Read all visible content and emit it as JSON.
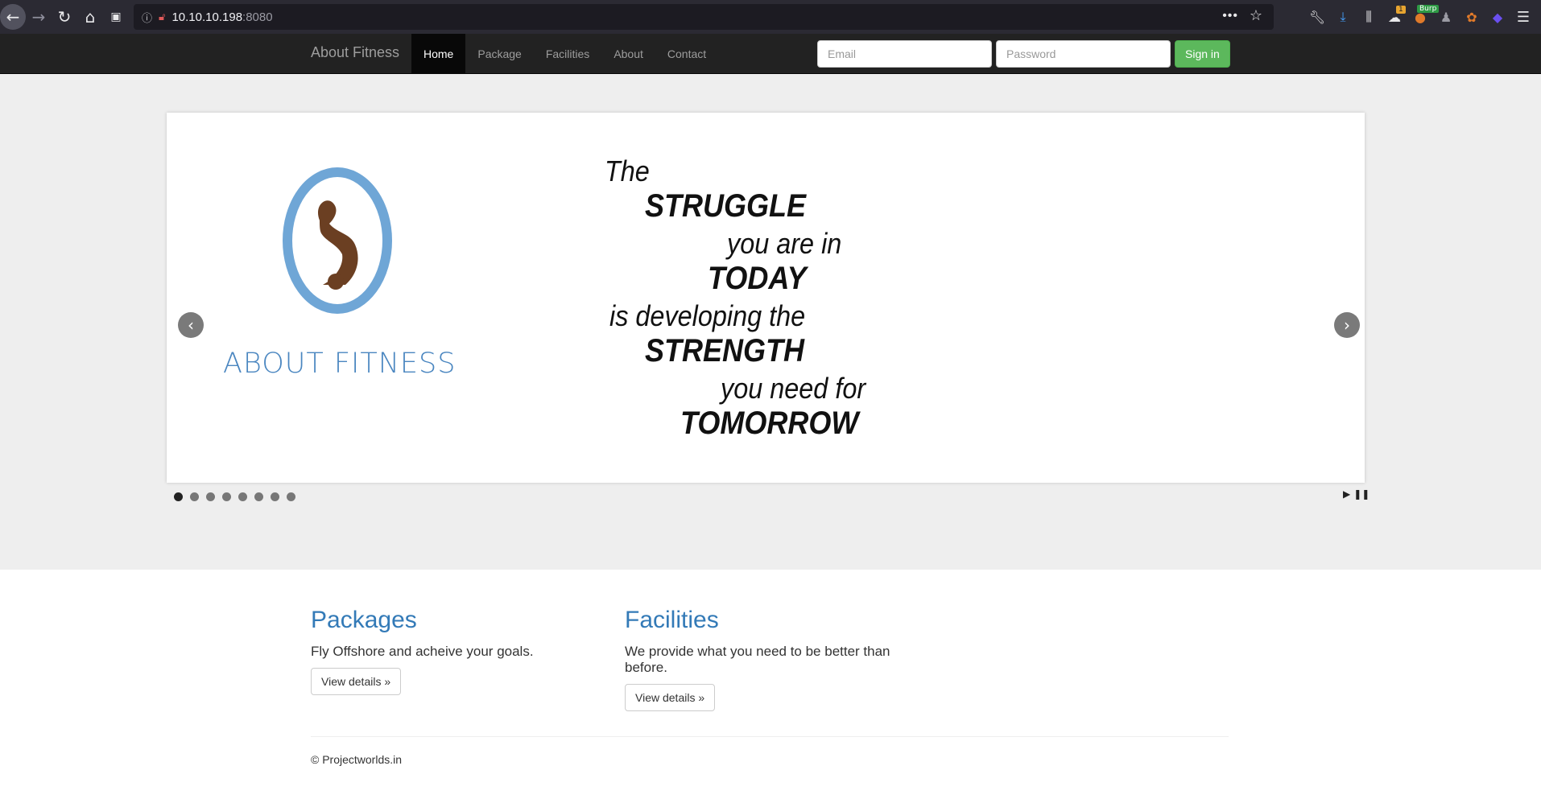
{
  "browser": {
    "url_host": "10.10.10.198",
    "url_port": ":8080",
    "icons": [
      "back-icon",
      "forward-icon",
      "reload-icon",
      "home-icon",
      "reader-icon",
      "info-icon",
      "insecure-lock-icon",
      "more-icon",
      "bookmark-star-icon",
      "wrench-icon",
      "download-icon",
      "library-icon",
      "extension-icon",
      "burp-icon",
      "extension-icon",
      "extension-icon",
      "extension-icon",
      "hamburger-menu-icon"
    ],
    "badge_count": "1",
    "burp_badge": "Burp"
  },
  "navbar": {
    "brand": "About Fitness",
    "links": [
      "Home",
      "Package",
      "Facilities",
      "About",
      "Contact"
    ],
    "active_index": 0,
    "email_placeholder": "Email",
    "password_placeholder": "Password",
    "signin_label": "Sign in"
  },
  "carousel": {
    "logo_text": "ABOUT FITNESS",
    "quote_lines": [
      "The",
      "STRUGGLE",
      "you are in",
      "TODAY",
      "is developing the",
      "STRENGTH",
      "you need for",
      "TOMORROW"
    ],
    "slide_count": 8,
    "active_slide": 0,
    "prev_glyph": "‹",
    "next_glyph": "›",
    "play_glyph": "▶",
    "pause_glyph": "❚❚"
  },
  "columns": [
    {
      "title": "Packages",
      "text": "Fly Offshore and acheive your goals.",
      "button": "View details »"
    },
    {
      "title": "Facilities",
      "text": "We provide what you need to be better than before.",
      "button": "View details »"
    }
  ],
  "footer": {
    "text": "© Projectworlds.in"
  },
  "colors": {
    "accent": "#337ab7",
    "success": "#5cb85c",
    "navbar": "#222222",
    "logo": "#6fa6d6"
  }
}
